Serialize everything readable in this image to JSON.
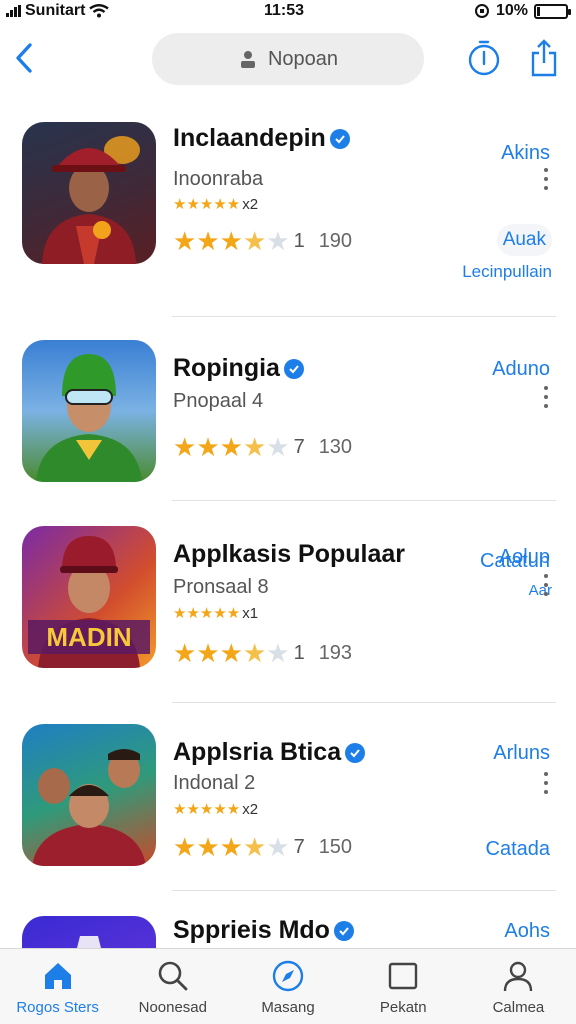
{
  "status_bar": {
    "carrier": "Sunitart",
    "time": "11:53",
    "battery": "10%",
    "battery_level": 0.1
  },
  "nav": {
    "search_placeholder": "Nopoan"
  },
  "apps": [
    {
      "title": "Inclaandepin",
      "subtitle": "Inoonraba",
      "small_stars": "★★★★★",
      "small_count": "x2",
      "rating_digit": "1",
      "rating_count": "190",
      "top_action": "Akins",
      "pill_label": "Auak",
      "extra_action": "Lecinpullain",
      "stars_filled": 3.5
    },
    {
      "title": "Ropingia",
      "subtitle": "Pnopaal 4",
      "rating_digit": "7",
      "rating_count": "130",
      "top_action": "Aduno",
      "pill_label": "Catatun",
      "extra_action": "Aar",
      "stars_filled": 3.5
    },
    {
      "title": "Applkasis Populaar",
      "subtitle": "Pronsaal 8",
      "small_stars": "★★★★★",
      "small_count": "x1",
      "rating_digit": "1",
      "rating_count": "193",
      "top_action": "Aolup",
      "stars_filled": 3.5
    },
    {
      "title": "Applsria Btica",
      "subtitle": "Indonal 2",
      "small_stars": "★★★★★",
      "small_count": "x2",
      "rating_digit": "7",
      "rating_count": "150",
      "top_action": "Arluns",
      "pill_label": "Catada",
      "stars_filled": 3.5
    },
    {
      "title": "Spprieis Mdo",
      "top_action": "Aohs"
    }
  ],
  "tabs": [
    {
      "label": "Rogos Sters",
      "icon": "home-icon",
      "active": true
    },
    {
      "label": "Noonesad",
      "icon": "search-icon",
      "active": false
    },
    {
      "label": "Masang",
      "icon": "compass-icon",
      "active": false
    },
    {
      "label": "Pekatn",
      "icon": "square-icon",
      "active": false
    },
    {
      "label": "Calmea",
      "icon": "person-icon",
      "active": false
    }
  ],
  "colors": {
    "accent": "#1e7ee8",
    "star": "#f3a617",
    "star_empty": "#d9dfe6"
  }
}
